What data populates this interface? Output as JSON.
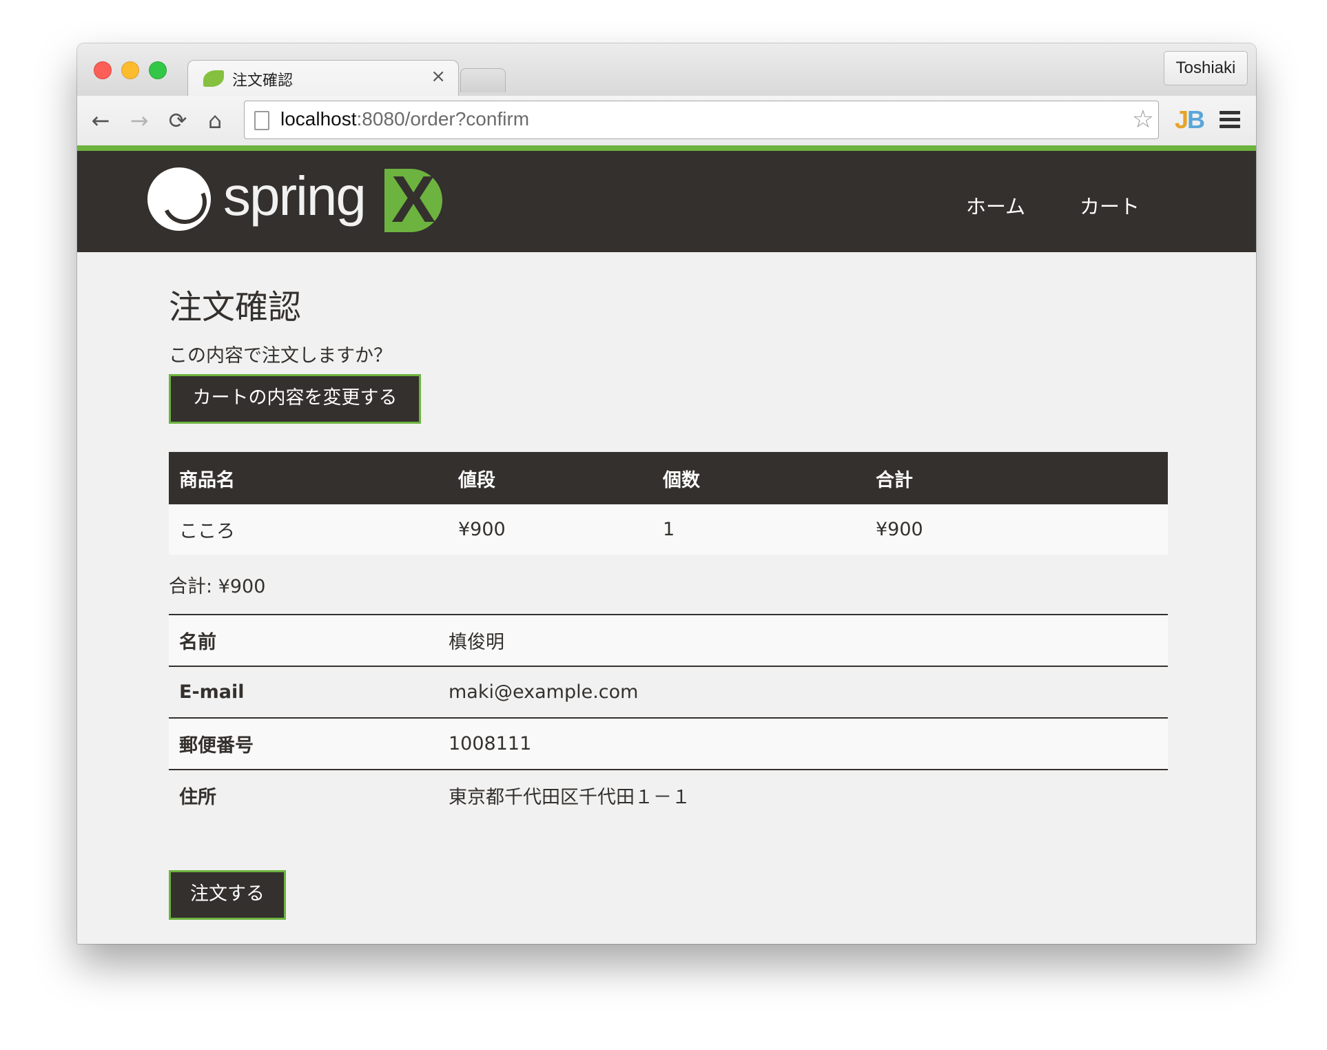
{
  "browser": {
    "tab_title": "注文確認",
    "tab_close": "×",
    "profile_name": "Toshiaki",
    "url_host": "localhost",
    "url_rest": ":8080/order?confirm",
    "extension_j": "J",
    "extension_b": "B",
    "back_glyph": "←",
    "forward_glyph": "→",
    "reload_glyph": "⟳",
    "home_glyph": "⌂",
    "star_glyph": "☆"
  },
  "header": {
    "logo_text": "spring",
    "logo_x": "X",
    "nav": {
      "home": "ホーム",
      "cart": "カート"
    },
    "accent_color": "#6db33f",
    "bg_color": "#34302d"
  },
  "main": {
    "title": "注文確認",
    "question": "この内容で注文しますか？",
    "change_button": "カートの内容を変更する",
    "cart_table": {
      "headers": [
        "商品名",
        "値段",
        "個数",
        "合計"
      ],
      "rows": [
        [
          "こころ",
          "¥900",
          "1",
          "¥900"
        ]
      ]
    },
    "total_text": "合計: ¥900",
    "customer": [
      {
        "key": "名前",
        "value": "槙俊明"
      },
      {
        "key": "E-mail",
        "value": "maki@example.com"
      },
      {
        "key": "郵便番号",
        "value": "1008111"
      },
      {
        "key": "住所",
        "value": "東京都千代田区千代田１－１"
      }
    ],
    "order_button": "注文する"
  }
}
